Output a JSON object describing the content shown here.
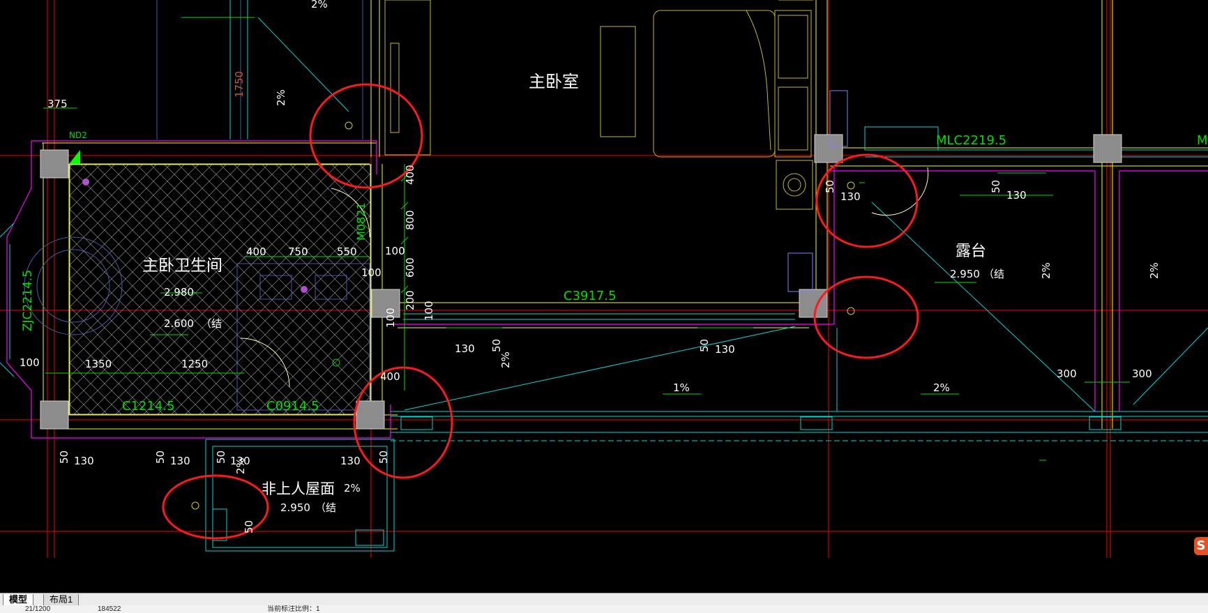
{
  "drawing": {
    "rooms": {
      "master_bedroom": "主卧室",
      "master_bathroom": "主卧卫生间",
      "terrace": "露台",
      "roof": "非上人屋面"
    },
    "elevations": {
      "bath_floor": "2.980",
      "bath_struct": "2.600",
      "bath_struct_note": "（结",
      "terrace": "2.950",
      "terrace_note": "（结",
      "roof": "2.950",
      "roof_note": "（结"
    },
    "openings": {
      "window_c3917": "C3917.5",
      "door_mlc2219": "MLC2219.5",
      "window_c1214": "C1214.5",
      "window_c0914": "C0914.5",
      "door_m0821": "M0821",
      "window_zjc": "ZJC2214.5",
      "partial_m": "M",
      "nd2": "ND2"
    },
    "dimensions": {
      "d375": "375",
      "d1750": "1750",
      "d400a": "400",
      "d750": "750",
      "d550": "550",
      "d100a": "100",
      "d100b": "100",
      "d100c": "100",
      "d100d": "100",
      "d100e": "100",
      "d400v": "400",
      "d800v": "800",
      "d600v": "600",
      "d200v": "200",
      "d1350": "1350",
      "d1250": "1250",
      "d400b": "400",
      "d50a": "50",
      "d130a": "130",
      "d50b": "50",
      "d130b": "130",
      "d50c": "50",
      "d130c": "130",
      "d130d": "130",
      "d50d": "50",
      "d50e": "50",
      "d130e": "130",
      "d50f": "50",
      "d130f": "130",
      "d50g": "50",
      "d130g": "130",
      "d50h": "50",
      "d130h": "130",
      "d50i": "50",
      "d300a": "300",
      "d300b": "300"
    },
    "slopes": {
      "s_top": "2%",
      "s_left": "2%",
      "s_mid": "2%",
      "s_1pct": "1%",
      "s_right1": "2%",
      "s_right2": "2%",
      "s_right3": "2%",
      "s_roof": "2%",
      "s_roof2": "2%"
    }
  },
  "tabs": {
    "model": "模型",
    "layout1": "布局1"
  },
  "status": {
    "scale": "21/1200",
    "coord": "184522",
    "annotation": "当前标注比例：1"
  },
  "logo": "S",
  "colors": {
    "background": "#000000",
    "axis": "#ff0000",
    "wall": "#ffff00",
    "glass": "#00ffff",
    "dim": "#00ff00",
    "text": "#ffffff",
    "magenta": "#ff00ff",
    "annotation_circle": "#ff1a1a"
  }
}
